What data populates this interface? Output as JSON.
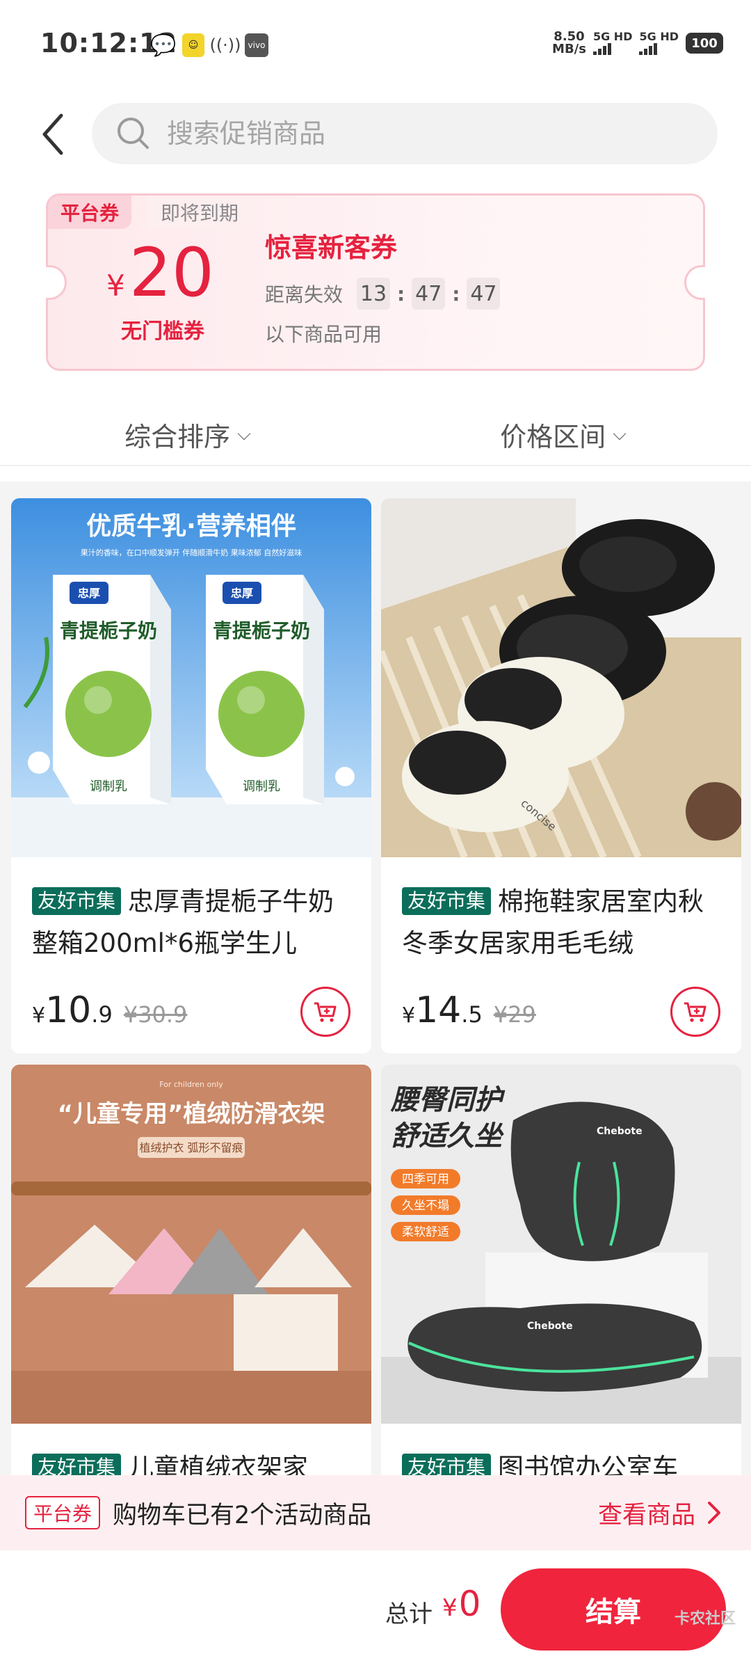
{
  "status_bar": {
    "time": "10:12:12",
    "speed_value": "8.50",
    "speed_unit": "MB/s",
    "sim1": "5G HD",
    "sim2": "5G HD",
    "battery": "100",
    "vivo": "vivo"
  },
  "search": {
    "placeholder": "搜索促销商品"
  },
  "coupon": {
    "tag": "平台券",
    "expire_label": "即将到期",
    "currency": "¥",
    "amount": "20",
    "condition": "无门槛券",
    "title": "惊喜新客券",
    "countdown_label": "距离失效",
    "countdown": {
      "h": "13",
      "m": "47",
      "s": "47"
    },
    "note": "以下商品可用"
  },
  "sort": {
    "comprehensive": "综合排序",
    "price_range": "价格区间"
  },
  "products": [
    {
      "badge": "友好市集",
      "title": "忠厚青提栀子牛奶整箱200ml*6瓶学生儿",
      "price_int": "10",
      "price_dec": ".9",
      "original": "¥30.9",
      "image_headline": "优质牛乳·营养相伴",
      "image_sub": "果汁的香味，在口中顺发弹开 伴随顺滑牛奶 果味浓郁 自然好滋味",
      "pack_brand": "忠厚",
      "pack_name": "青提栀子奶",
      "pack_type": "调制乳"
    },
    {
      "badge": "友好市集",
      "title": "棉拖鞋家居室内秋冬季女居家用毛毛绒",
      "price_int": "14",
      "price_dec": ".5",
      "original": "¥29",
      "brand_text": "concise"
    },
    {
      "badge": "友好市集",
      "title": "儿童植绒衣架家",
      "image_headline": "“儿童专用”植绒防滑衣架",
      "image_sub": "植绒护衣 弧形不留痕",
      "image_top": "For children only"
    },
    {
      "badge": "友好市集",
      "title": "图书馆办公室车",
      "image_headline_1": "腰臀同护",
      "image_headline_2": "舒适久坐",
      "features": [
        "四季可用",
        "久坐不塌",
        "柔软舒适"
      ],
      "brand_text": "Chebote"
    }
  ],
  "cart_banner": {
    "tag": "平台券",
    "message": "购物车已有2个活动商品",
    "view": "查看商品"
  },
  "footer": {
    "total_label": "总计",
    "currency": "¥",
    "total_value": "0",
    "checkout": "结算",
    "watermark": "卡农社区"
  },
  "colors": {
    "accent": "#e5223f",
    "badge": "#0b6e5a",
    "coupon_bg": "#fde9ec"
  }
}
